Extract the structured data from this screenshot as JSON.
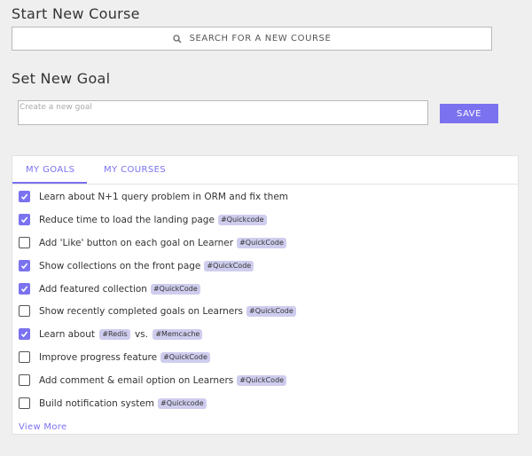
{
  "start_course": {
    "title": "Start New Course",
    "search_placeholder": "SEARCH FOR A NEW COURSE",
    "search_icon": "search-icon"
  },
  "set_goal": {
    "title": "Set New Goal",
    "input_placeholder": "Create a new goal",
    "input_value": "",
    "save_label": "SAVE"
  },
  "colors": {
    "accent": "#7b72f0",
    "tag_bg": "#cfcdee",
    "page_bg": "#efefef"
  },
  "tabs": [
    {
      "label": "MY GOALS",
      "active": true
    },
    {
      "label": "MY COURSES",
      "active": false
    }
  ],
  "goals": [
    {
      "text": "Learn about N+1 query problem in ORM and fix them",
      "checked": true,
      "tags": []
    },
    {
      "text": "Reduce time to load the landing page",
      "checked": true,
      "tags": [
        "#Quickcode"
      ]
    },
    {
      "text": "Add 'Like' button on each goal on Learner",
      "checked": false,
      "tags": [
        "#QuickCode"
      ]
    },
    {
      "text": "Show collections on the front page",
      "checked": true,
      "tags": [
        "#QuickCode"
      ]
    },
    {
      "text": "Add featured collection",
      "checked": true,
      "tags": [
        "#QuickCode"
      ]
    },
    {
      "text": "Show recently completed goals on Learners",
      "checked": false,
      "tags": [
        "#QuickCode"
      ]
    },
    {
      "text_parts": [
        "Learn about",
        "#Redis",
        "vs.",
        "#Memcache"
      ],
      "checked": true
    },
    {
      "text": "Improve progress feature",
      "checked": false,
      "tags": [
        "#QuickCode"
      ]
    },
    {
      "text": "Add comment & email option on Learners",
      "checked": false,
      "tags": [
        "#QuickCode"
      ]
    },
    {
      "text": "Build notification system",
      "checked": false,
      "tags": [
        "#Quickcode"
      ]
    }
  ],
  "view_more_label": "View More"
}
